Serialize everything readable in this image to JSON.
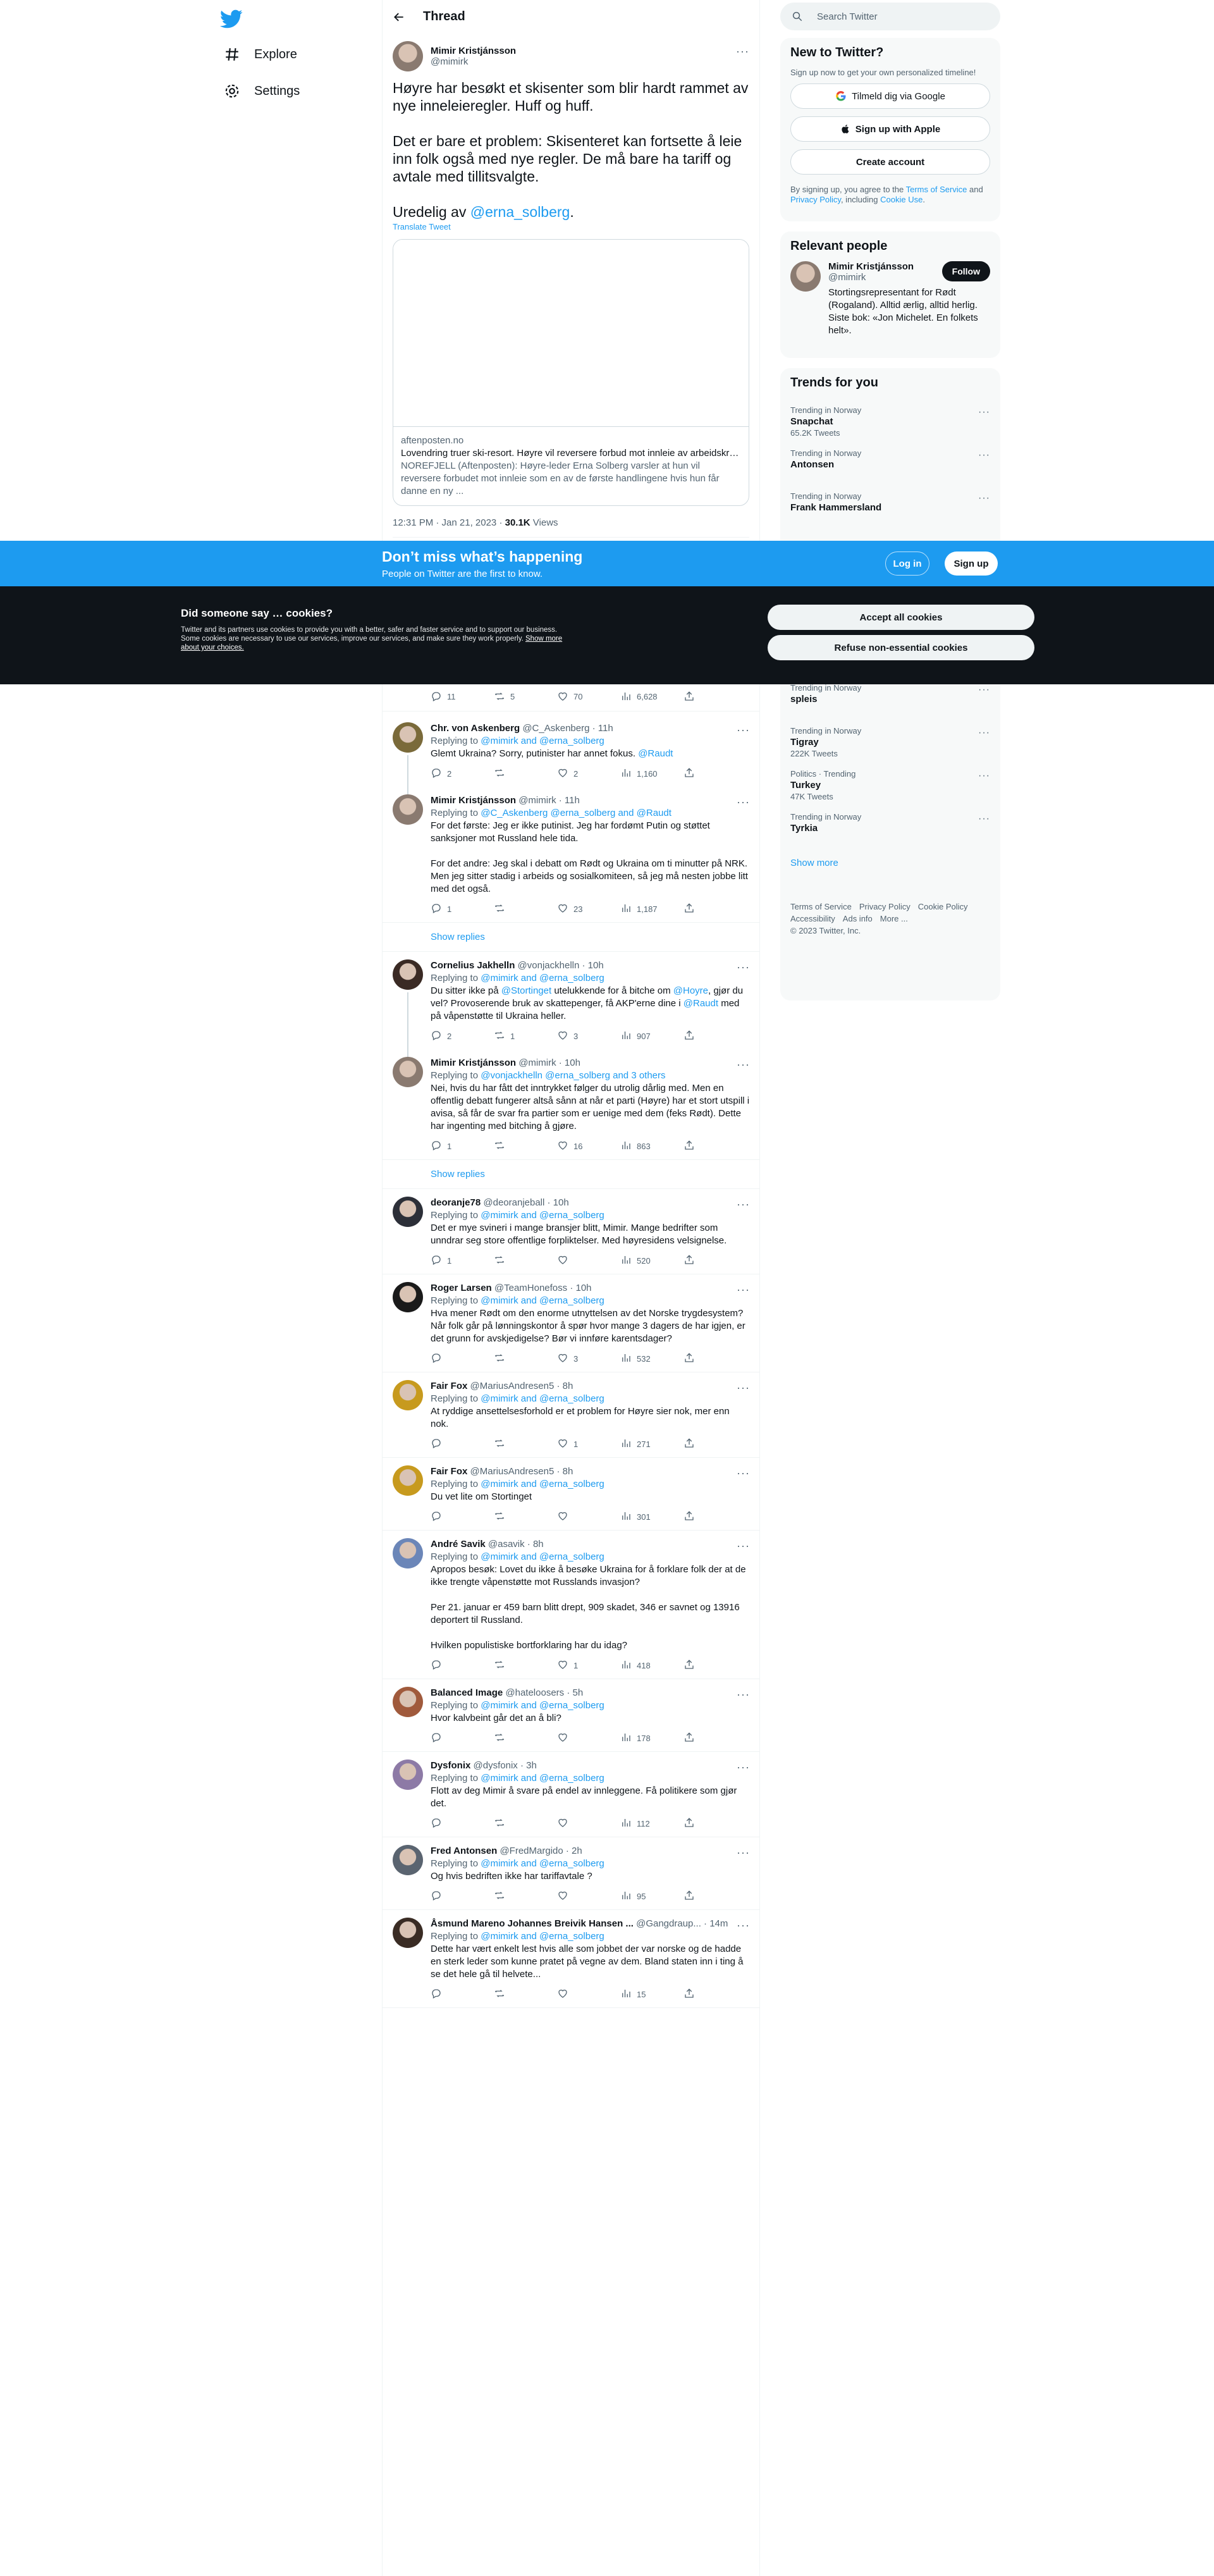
{
  "nav": {
    "explore": "Explore",
    "settings": "Settings"
  },
  "header": {
    "title": "Thread"
  },
  "focal": {
    "name": "Mimir Kristjánsson",
    "handle": "@mimirk",
    "p1": "Høyre har besøkt et skisenter som blir hardt rammet av nye inneleieregler. Huff og huff.",
    "p2": "Det er bare et problem: Skisenteret kan fortsette å leie inn folk også med nye regler. De må bare ha tariff og avtale med tillitsvalgte.",
    "p3_prefix": "Uredelig av ",
    "p3_mention": "@erna_solberg",
    "p3_suffix": ".",
    "translate": "Translate Tweet",
    "card": {
      "domain": "aftenposten.no",
      "title": "Lovendring truer ski-resort. Høyre vil reversere forbud mot innleie av arbeidskra...",
      "desc": "NOREFJELL (Aftenposten): Høyre-leder Erna Solberg varsler at hun vil reversere forbudet mot innleie som en av de første handlingene hvis hun får danne en ny ..."
    },
    "time": "12:31 PM · Jan 21, 2023 · ",
    "views_count": "30.1K",
    "views_label": " Views"
  },
  "first_actions": {
    "replies": "11",
    "retweets": "5",
    "likes": "70",
    "views": "6,628"
  },
  "replies": [
    {
      "name": "Chr. von Askenberg",
      "handle": "@C_Askenberg · 11h",
      "replying": "@mimirk and @erna_solberg",
      "body": [
        "Glemt Ukraina? Sorry, putinister har annet fokus. @Raudt"
      ],
      "replies": "2",
      "retweets": "",
      "likes": "2",
      "views": "1,160",
      "avatar": "#7a6a3a"
    },
    {
      "name": "Mimir Kristjánsson",
      "handle": "@mimirk · 11h",
      "replying": "@C_Askenberg @erna_solberg and @Raudt",
      "body": [
        "For det første: Jeg er ikke putinist. Jeg har fordømt Putin og støttet sanksjoner mot Russland hele tida.",
        "For det andre: Jeg skal i debatt om Rødt og Ukraina om ti minutter på NRK. Men jeg sitter stadig i arbeids og sosialkomiteen, så jeg må nesten jobbe litt med det også."
      ],
      "replies": "1",
      "retweets": "",
      "likes": "23",
      "views": "1,187",
      "avatar": "#8a7a70"
    },
    {
      "name": "Cornelius Jakhelln",
      "handle": "@vonjackhelln · 10h",
      "replying": "@mimirk and @erna_solberg",
      "body": [
        "Du sitter ikke på @Stortinget utelukkende for å bitche om @Hoyre, gjør du vel? Provoserende bruk av skattepenger, få AKP'erne dine i @Raudt med på våpenstøtte til Ukraina heller."
      ],
      "replies": "2",
      "retweets": "1",
      "likes": "3",
      "views": "907",
      "avatar": "#3a2a24"
    },
    {
      "name": "Mimir Kristjánsson",
      "handle": "@mimirk · 10h",
      "replying": "@vonjackhelln @erna_solberg and 3 others",
      "body": [
        "Nei, hvis du har fått det inntrykket følger du utrolig dårlig med. Men en offentlig debatt fungerer altså sånn at når et parti (Høyre) har et stort utspill i avisa, så får de svar fra partier som er uenige med dem (feks Rødt). Dette har ingenting med bitching å gjøre."
      ],
      "replies": "1",
      "retweets": "",
      "likes": "16",
      "views": "863",
      "avatar": "#8a7a70"
    },
    {
      "name": "deoranje78",
      "handle": "@deoranjeball · 10h",
      "replying": "@mimirk and @erna_solberg",
      "body": [
        "Det er mye svineri i mange bransjer blitt, Mimir. Mange bedrifter som unndrar seg store offentlige forpliktelser. Med høyresidens velsignelse."
      ],
      "replies": "1",
      "retweets": "",
      "likes": "",
      "views": "520",
      "avatar": "#2c2f38"
    },
    {
      "name": "Roger Larsen",
      "handle": "@TeamHonefoss · 10h",
      "replying": "@mimirk and @erna_solberg",
      "body": [
        "Hva mener Rødt om den enorme utnyttelsen av det Norske trygdesystem? Når folk går på lønningskontor å spør hvor mange 3 dagers de har igjen, er det grunn for avskjedigelse? Bør vi innføre karentsdager?"
      ],
      "replies": "",
      "retweets": "",
      "likes": "3",
      "views": "532",
      "avatar": "#1a1a1a"
    },
    {
      "name": "Fair Fox",
      "handle": "@MariusAndresen5 · 8h",
      "replying": "@mimirk and @erna_solberg",
      "body": [
        "At ryddige ansettelsesforhold er et problem for Høyre sier nok, mer enn nok."
      ],
      "replies": "",
      "retweets": "",
      "likes": "1",
      "views": "271",
      "avatar": "#c79a1e"
    },
    {
      "name": "Fair Fox",
      "handle": "@MariusAndresen5 · 8h",
      "replying": "@mimirk and @erna_solberg",
      "body": [
        "Du vet lite om Stortinget"
      ],
      "replies": "",
      "retweets": "",
      "likes": "",
      "views": "301",
      "avatar": "#c79a1e"
    },
    {
      "name": "André Savik",
      "handle": "@asavik · 8h",
      "replying": "@mimirk and @erna_solberg",
      "body": [
        "Apropos besøk: Lovet du ikke å besøke Ukraina for å forklare folk der at de ikke trengte våpenstøtte mot Russlands invasjon?",
        "Per 21. januar er 459 barn blitt drept, 909 skadet, 346 er savnet og 13916 deportert til Russland.",
        "Hvilken populistiske bortforklaring har du idag?"
      ],
      "replies": "",
      "retweets": "",
      "likes": "1",
      "views": "418",
      "avatar": "#6b86b8"
    },
    {
      "name": "Balanced Image",
      "handle": "@hateloosers · 5h",
      "replying": "@mimirk and @erna_solberg",
      "body": [
        "Hvor kalvbeint går det an å bli?"
      ],
      "replies": "",
      "retweets": "",
      "likes": "",
      "views": "178",
      "avatar": "#a05a3c"
    },
    {
      "name": "Dysfonix",
      "handle": "@dysfonix · 3h",
      "replying": "@mimirk and @erna_solberg",
      "body": [
        "Flott av deg Mimir å svare på endel av innleggene. Få politikere som gjør det."
      ],
      "replies": "",
      "retweets": "",
      "likes": "",
      "views": "112",
      "avatar": "#8d7aa6"
    },
    {
      "name": "Fred Antonsen",
      "handle": "@FredMargido · 2h",
      "replying": "@mimirk and @erna_solberg",
      "body": [
        "Og hvis bedriften ikke har tariffavtale ?"
      ],
      "replies": "",
      "retweets": "",
      "likes": "",
      "views": "95",
      "avatar": "#5a6470"
    },
    {
      "name": "Åsmund Mareno Johannes Breivik Hansen ...",
      "handle": "@Gangdraup... · 14m",
      "replying": "@mimirk and @erna_solberg",
      "body": [
        "Dette har vært enkelt lest hvis alle som jobbet der var norske og de hadde en sterk leder som kunne pratet på vegne av dem. Bland staten inn i ting å se det hele gå til helvete..."
      ],
      "replies": "",
      "retweets": "",
      "likes": "",
      "views": "15",
      "avatar": "#3a2c24"
    }
  ],
  "show_replies": "Show replies",
  "replying_to_label": "Replying to ",
  "sidebar": {
    "search_placeholder": "Search Twitter",
    "new_title": "New to Twitter?",
    "new_sub": "Sign up now to get your own personalized timeline!",
    "google": "Tilmeld dig via Google",
    "apple": "Sign up with Apple",
    "create": "Create account",
    "terms_1": "By signing up, you agree to the ",
    "terms_tos": "Terms of Service",
    "terms_2": " and ",
    "terms_pp": "Privacy Policy",
    "terms_3": ", including ",
    "terms_cu": "Cookie Use",
    "terms_4": ".",
    "relevant_title": "Relevant people",
    "rp_name": "Mimir Kristjánsson",
    "rp_handle": "@mimirk",
    "rp_bio": "Stortingsrepresentant for Rødt (Rogaland). Alltid ærlig, alltid herlig. Siste bok: «Jon Michelet. En folkets helt».",
    "follow": "Follow",
    "trends_title": "Trends for you",
    "trends_top": [
      {
        "ctx": "Trending in Norway",
        "name": "Snapchat",
        "count": "65.2K Tweets"
      },
      {
        "ctx": "Trending in Norway",
        "name": "Antonsen",
        "count": ""
      },
      {
        "ctx": "Trending in Norway",
        "name": "Frank Hammersland",
        "count": ""
      }
    ],
    "trends_bottom": [
      {
        "ctx": "Trending in Norway",
        "name": "spleis",
        "count": ""
      },
      {
        "ctx": "Trending in Norway",
        "name": "Tigray",
        "count": "222K Tweets"
      },
      {
        "ctx": "Politics · Trending",
        "name": "Turkey",
        "count": "47K Tweets"
      },
      {
        "ctx": "Trending in Norway",
        "name": "Tyrkia",
        "count": ""
      }
    ],
    "show_more": "Show more",
    "footer": [
      "Terms of Service",
      "Privacy Policy",
      "Cookie Policy",
      "Accessibility",
      "Ads info",
      "More ...",
      "© 2023 Twitter, Inc."
    ]
  },
  "signup_bar": {
    "title": "Don’t miss what’s happening",
    "sub": "People on Twitter are the first to know.",
    "login": "Log in",
    "signup": "Sign up"
  },
  "cookies": {
    "title": "Did someone say … cookies?",
    "desc": "Twitter and its partners use cookies to provide you with a better, safer and faster service and to support our business. Some cookies are necessary to use our services, improve our services, and make sure they work properly. ",
    "link": "Show more about your choices.",
    "accept": "Accept all cookies",
    "refuse": "Refuse non-essential cookies"
  },
  "colors": {
    "accent": "#1d9bf0",
    "text": "#0f1419",
    "muted": "#536471",
    "border": "#eff3f4"
  }
}
